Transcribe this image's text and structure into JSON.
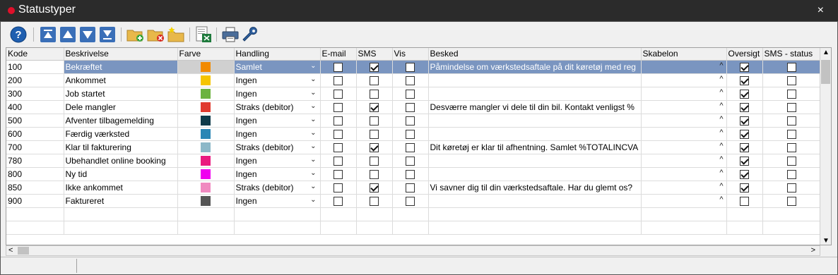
{
  "window": {
    "title": "Statustyper",
    "close_glyph": "×"
  },
  "toolbar": {
    "buttons": [
      {
        "name": "help-icon"
      },
      {
        "name": "move-top-icon"
      },
      {
        "name": "move-up-icon"
      },
      {
        "name": "move-down-icon"
      },
      {
        "name": "move-bottom-icon"
      },
      {
        "name": "add-folder-icon"
      },
      {
        "name": "delete-folder-icon"
      },
      {
        "name": "new-folder-icon"
      },
      {
        "name": "export-excel-icon"
      },
      {
        "name": "print-icon"
      },
      {
        "name": "settings-wrench-icon"
      }
    ]
  },
  "grid": {
    "headers": [
      "Kode",
      "Beskrivelse",
      "Farve",
      "Handling",
      "E-mail",
      "SMS",
      "Vis",
      "Besked",
      "Skabelon",
      "Oversigt",
      "SMS - status"
    ],
    "rows": [
      {
        "kode": "100",
        "beskrivelse": "Bekræftet",
        "color": "#f28a00",
        "handling": "Samlet",
        "email": false,
        "sms": true,
        "vis": false,
        "besked": "Påmindelse om værkstedsaftale på dit køretøj med reg",
        "oversigt": true,
        "smsstatus": false,
        "selected": true
      },
      {
        "kode": "200",
        "beskrivelse": "Ankommet",
        "color": "#f5c400",
        "handling": "Ingen",
        "email": false,
        "sms": false,
        "vis": false,
        "besked": "",
        "oversigt": true,
        "smsstatus": false
      },
      {
        "kode": "300",
        "beskrivelse": "Job startet",
        "color": "#6cb33f",
        "handling": "Ingen",
        "email": false,
        "sms": false,
        "vis": false,
        "besked": "",
        "oversigt": true,
        "smsstatus": false
      },
      {
        "kode": "400",
        "beskrivelse": "Dele mangler",
        "color": "#e03a2f",
        "handling": "Straks (debitor)",
        "email": false,
        "sms": true,
        "vis": false,
        "besked": "Desværre mangler vi dele til din bil. Kontakt venligst %",
        "oversigt": true,
        "smsstatus": false
      },
      {
        "kode": "500",
        "beskrivelse": "Afventer tilbagemelding",
        "color": "#0e3a4a",
        "handling": "Ingen",
        "email": false,
        "sms": false,
        "vis": false,
        "besked": "",
        "oversigt": true,
        "smsstatus": false
      },
      {
        "kode": "600",
        "beskrivelse": "Færdig værksted",
        "color": "#2a86b5",
        "handling": "Ingen",
        "email": false,
        "sms": false,
        "vis": false,
        "besked": "",
        "oversigt": true,
        "smsstatus": false
      },
      {
        "kode": "700",
        "beskrivelse": "Klar til fakturering",
        "color": "#8cb8c8",
        "handling": "Straks (debitor)",
        "email": false,
        "sms": true,
        "vis": false,
        "besked": "Dit køretøj er klar til afhentning. Samlet %TOTALINCVA",
        "oversigt": true,
        "smsstatus": false
      },
      {
        "kode": "780",
        "beskrivelse": "Ubehandlet online booking",
        "color": "#ea1a7f",
        "handling": "Ingen",
        "email": false,
        "sms": false,
        "vis": false,
        "besked": "",
        "oversigt": true,
        "smsstatus": false
      },
      {
        "kode": "800",
        "beskrivelse": "Ny tid",
        "color": "#f000f0",
        "handling": "Ingen",
        "email": false,
        "sms": false,
        "vis": false,
        "besked": "",
        "oversigt": true,
        "smsstatus": false
      },
      {
        "kode": "850",
        "beskrivelse": "Ikke ankommet",
        "color": "#f08ac0",
        "handling": "Straks (debitor)",
        "email": false,
        "sms": true,
        "vis": false,
        "besked": "Vi savner dig til din værkstedsaftale. Har du glemt os?",
        "oversigt": true,
        "smsstatus": false
      },
      {
        "kode": "900",
        "beskrivelse": "Faktureret",
        "color": "#555555",
        "handling": "Ingen",
        "email": false,
        "sms": false,
        "vis": false,
        "besked": "",
        "oversigt": false,
        "smsstatus": false
      }
    ],
    "empty_rows": 2
  },
  "glyphs": {
    "chevron": "⌄",
    "caret_up": "^",
    "arrow_up": "▲",
    "arrow_down": "▼",
    "arrow_left": "<",
    "arrow_right": ">"
  }
}
